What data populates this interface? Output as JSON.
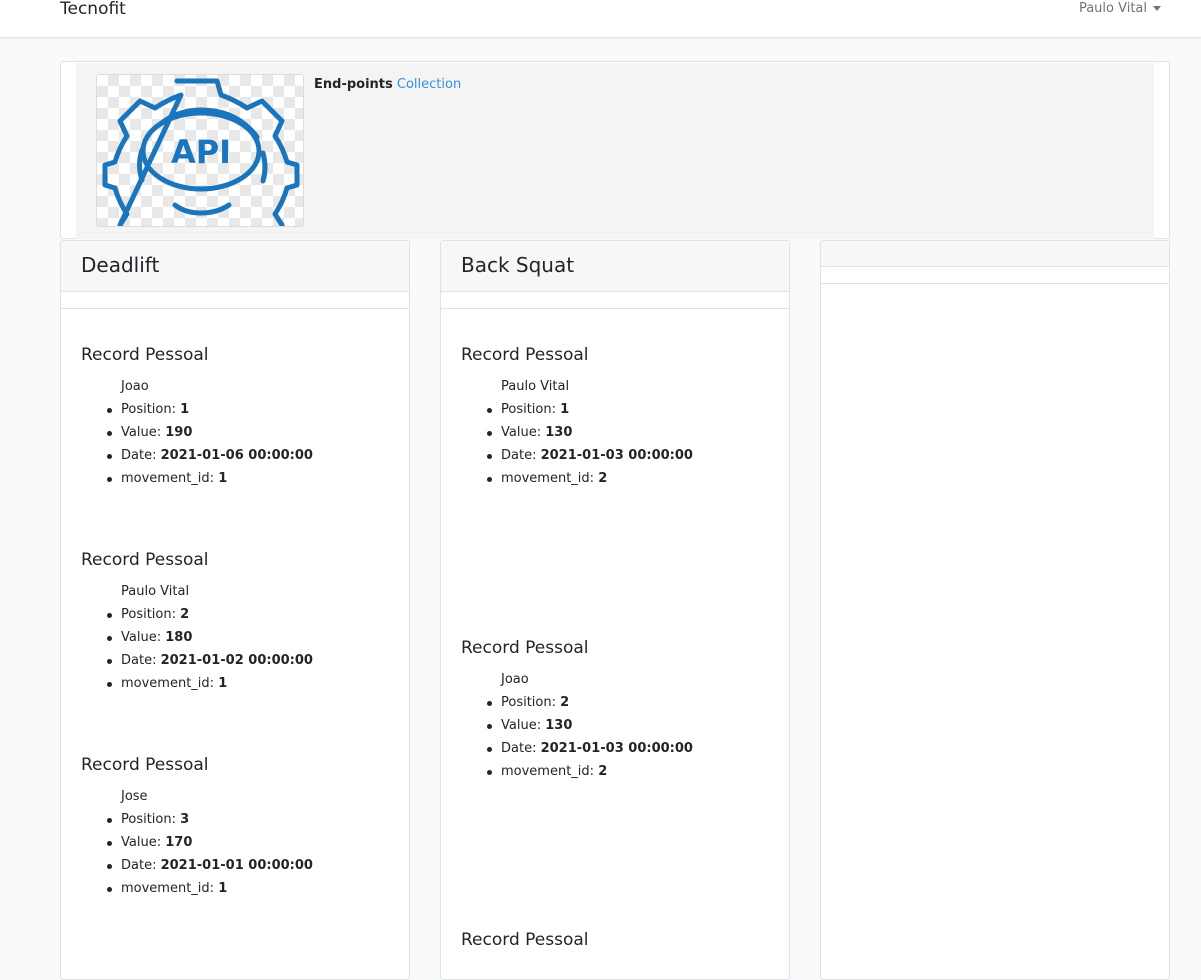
{
  "navbar": {
    "brand": "Tecnofit",
    "user_name": "Paulo Vital"
  },
  "header": {
    "image_label": "API",
    "endpoints_label": "End-points",
    "collection_link": "Collection"
  },
  "labels": {
    "position": "Position:",
    "value": "Value:",
    "date": "Date:",
    "movement_id": "movement_id:"
  },
  "columns": [
    {
      "title": "Deadlift",
      "records": [
        {
          "heading": "Record Pessoal",
          "name": "Joao",
          "position": "1",
          "value": "190",
          "date": "2021-01-06 00:00:00",
          "movement_id": "1"
        },
        {
          "heading": "Record Pessoal",
          "name": "Paulo Vital",
          "position": "2",
          "value": "180",
          "date": "2021-01-02 00:00:00",
          "movement_id": "1"
        },
        {
          "heading": "Record Pessoal",
          "name": "Jose",
          "position": "3",
          "value": "170",
          "date": "2021-01-01 00:00:00",
          "movement_id": "1"
        }
      ]
    },
    {
      "title": "Back Squat",
      "records": [
        {
          "heading": "Record Pessoal",
          "name": "Paulo Vital",
          "position": "1",
          "value": "130",
          "date": "2021-01-03 00:00:00",
          "movement_id": "2"
        },
        {
          "heading": "Record Pessoal",
          "name": "Joao",
          "position": "2",
          "value": "130",
          "date": "2021-01-03 00:00:00",
          "movement_id": "2"
        },
        {
          "heading": "Record Pessoal"
        }
      ]
    },
    {
      "title": "",
      "records": []
    }
  ]
}
